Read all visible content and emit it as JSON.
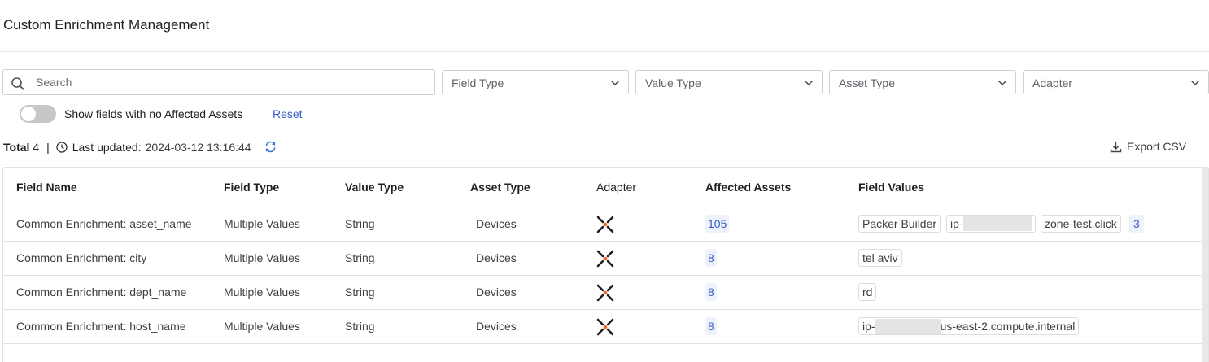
{
  "page": {
    "title": "Custom Enrichment Management"
  },
  "filters": {
    "search_placeholder": "Search",
    "field_type": "Field Type",
    "value_type": "Value Type",
    "asset_type": "Asset Type",
    "adapter": "Adapter"
  },
  "toggle": {
    "label": "Show fields with no Affected Assets",
    "checked": false
  },
  "reset_label": "Reset",
  "summary": {
    "total_label": "Total",
    "total_value": "4",
    "separator": "|",
    "updated_label": "Last updated:",
    "updated_value": "2024-03-12 13:16:44"
  },
  "export_label": "Export CSV",
  "table": {
    "columns": [
      "Field Name",
      "Field Type",
      "Value Type",
      "Asset Type",
      "Adapter",
      "Affected Assets",
      "Field Values"
    ],
    "rows": [
      {
        "field_name": "Common Enrichment: asset_name",
        "field_type": "Multiple Values",
        "value_type": "String",
        "asset_type": "Devices",
        "adapter_icon": "enrichment-adapter-icon",
        "affected": "105",
        "values": [
          "Packer Builder",
          "ip-",
          "zone-test.click"
        ],
        "more": "3"
      },
      {
        "field_name": "Common Enrichment: city",
        "field_type": "Multiple Values",
        "value_type": "String",
        "asset_type": "Devices",
        "adapter_icon": "enrichment-adapter-icon",
        "affected": "8",
        "values": [
          "tel aviv"
        ]
      },
      {
        "field_name": "Common Enrichment: dept_name",
        "field_type": "Multiple Values",
        "value_type": "String",
        "asset_type": "Devices",
        "adapter_icon": "enrichment-adapter-icon",
        "affected": "8",
        "values": [
          "rd"
        ]
      },
      {
        "field_name": "Common Enrichment: host_name",
        "field_type": "Multiple Values",
        "value_type": "String",
        "asset_type": "Devices",
        "adapter_icon": "enrichment-adapter-icon",
        "affected": "8",
        "values": [
          "ip-",
          "us-east-2.compute.internal"
        ]
      }
    ]
  },
  "colors": {
    "accent": "#3a5cc7",
    "badge_bg": "#eef2fb",
    "adapter_center": "#f26522"
  }
}
